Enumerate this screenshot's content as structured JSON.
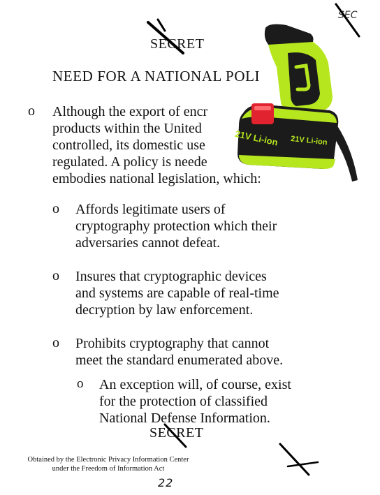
{
  "document": {
    "classification_top": "SECRET",
    "title": "NEED FOR A NATIONAL POLI",
    "main_bullet": "o",
    "main_paragraph": [
      "Although the export of encr",
      "products within the United",
      "controlled, its domestic use",
      "regulated.  A policy is neede",
      "embodies national legislation, which:"
    ],
    "sub_items": [
      {
        "bullet": "o",
        "lines": [
          "Affords legitimate users of",
          "cryptography protection which their",
          "adversaries cannot defeat."
        ]
      },
      {
        "bullet": "o",
        "lines": [
          "Insures that cryptographic devices",
          "and systems are capable of real-time",
          "decryption by law enforcement."
        ]
      },
      {
        "bullet": "o",
        "lines": [
          "Prohibits cryptography that cannot",
          "meet the standard enumerated above."
        ]
      }
    ],
    "sub_sub_item": {
      "bullet": "o",
      "lines": [
        "An exception will, of course, exist",
        "for the protection of classified",
        "National Defense Information."
      ]
    },
    "classification_bottom": "SECRET",
    "footer_lines": [
      "Obtained by the Electronic Privacy Information Center",
      "under the Freedom of Information Act"
    ],
    "page_number": "22",
    "corner_mark": "SEC"
  },
  "overlay": {
    "drill_battery_label": "21V Li-ion",
    "drill_body_color": "#b6e61e",
    "drill_dark_color": "#1b1b1b",
    "button_color": "#e0232e",
    "icon": "cordless-drill-image"
  },
  "colors": {
    "page": "#ffffff",
    "text": "#111111"
  }
}
